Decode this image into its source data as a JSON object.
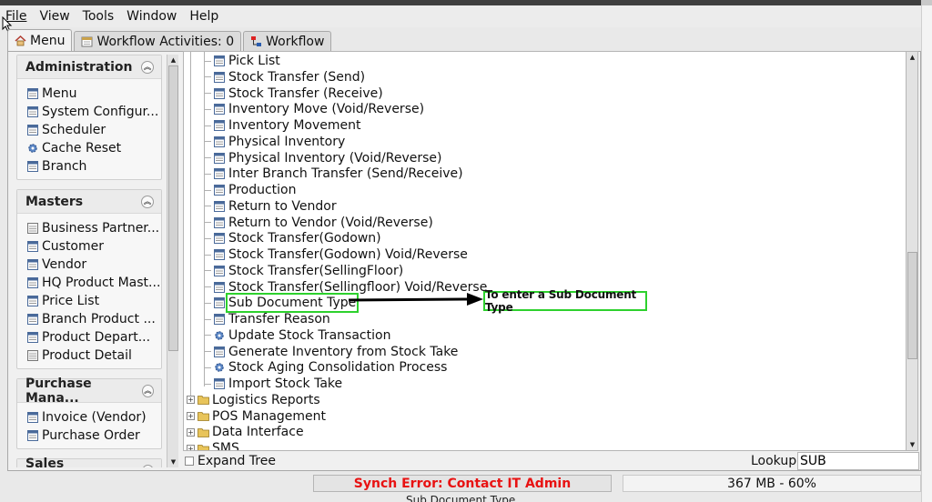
{
  "menubar": {
    "items": [
      "File",
      "View",
      "Tools",
      "Window",
      "Help"
    ]
  },
  "tabs": {
    "menu": "Menu",
    "workflow_activities": "Workflow Activities: 0",
    "workflow": "Workflow"
  },
  "sidebar": {
    "administration": {
      "title": "Administration",
      "items": [
        "Menu",
        "System Configur...",
        "Scheduler",
        "Cache Reset",
        "Branch"
      ]
    },
    "masters": {
      "title": "Masters",
      "items": [
        "Business Partner...",
        "Customer",
        "Vendor",
        "HQ Product Mast...",
        "Price List",
        "Branch Product ...",
        "Product Depart...",
        "Product Detail"
      ]
    },
    "purchase": {
      "title": "Purchase Mana...",
      "items": [
        "Invoice (Vendor)",
        "Purchase Order"
      ]
    },
    "sales": {
      "title": "Sales Managem..."
    }
  },
  "tree": {
    "items": [
      "Pick List",
      "Stock Transfer (Send)",
      "Stock Transfer (Receive)",
      "Inventory Move (Void/Reverse)",
      "Inventory Movement",
      "Physical Inventory",
      "Physical Inventory (Void/Reverse)",
      "Inter Branch Transfer (Send/Receive)",
      "Production",
      "Return to Vendor",
      "Return to Vendor (Void/Reverse)",
      "Stock Transfer(Godown)",
      "Stock Transfer(Godown) Void/Reverse",
      "Stock Transfer(SellingFloor)",
      "Stock Transfer(Sellingfloor) Void/Reverse",
      "Sub Document Type",
      "Transfer Reason",
      "Update Stock Transaction",
      "Generate Inventory from Stock Take",
      "Stock Aging Consolidation Process",
      "Import Stock Take"
    ],
    "folders": [
      "Logistics Reports",
      "POS Management",
      "Data Interface",
      "SMS"
    ]
  },
  "annotation": "To enter a Sub Document Type",
  "bottom": {
    "expand_tree": "Expand Tree",
    "lookup_label": "Lookup",
    "lookup_value": "SUB"
  },
  "status": {
    "sync_error": "Synch Error: Contact IT Admin",
    "memory_info": "367 MB - 60%"
  },
  "footer_text": "Sub Document Type",
  "colors": {
    "highlight": "#2dd12d",
    "error": "#e81212"
  }
}
